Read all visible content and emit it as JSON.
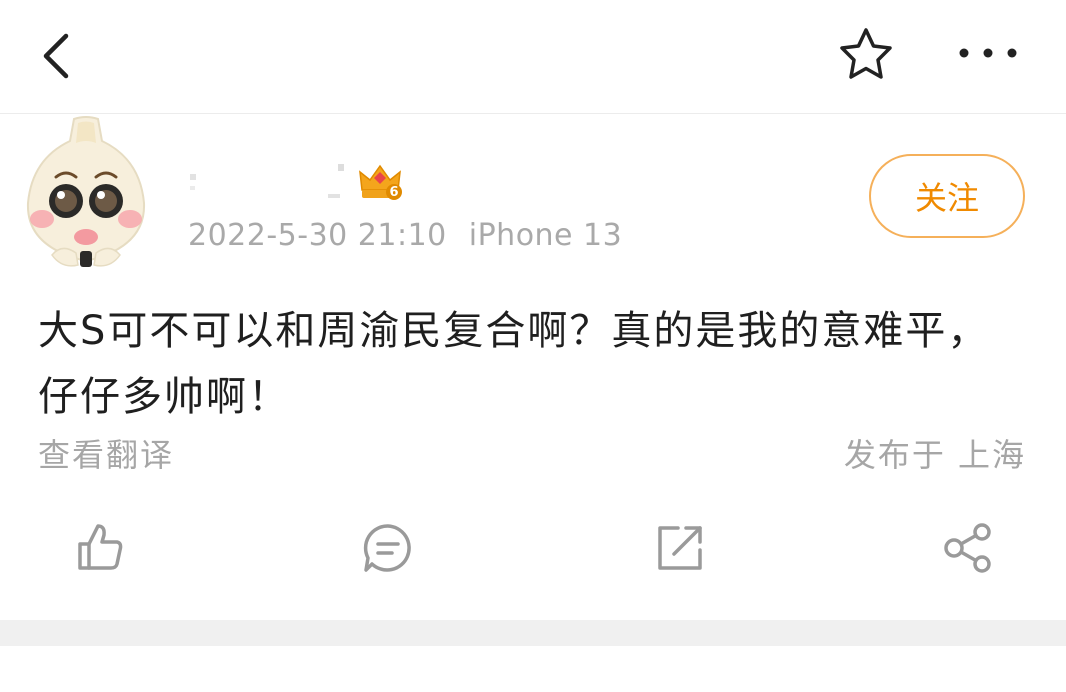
{
  "nav": {
    "back_icon": "chevron-left-icon",
    "favorite_icon": "star-outline-icon",
    "more_icon": "more-horizontal-icon"
  },
  "post": {
    "author": {
      "avatar": "garlic-character-avatar",
      "badge_icon": "crown-level-badge-icon",
      "badge_level": "6"
    },
    "date": "2022-5-30 21:10",
    "device": "iPhone 13",
    "follow_label": "关注",
    "text": "大S可不可以和周渝民复合啊？真的是我的意难平，仔仔多帅啊！",
    "translate_label": "查看翻译",
    "location": "发布于 上海"
  },
  "actions": [
    {
      "name": "like",
      "icon": "thumbs-up-icon"
    },
    {
      "name": "comment",
      "icon": "comment-bubble-icon"
    },
    {
      "name": "repost",
      "icon": "repost-arrow-icon"
    },
    {
      "name": "share",
      "icon": "share-nodes-icon"
    }
  ],
  "colors": {
    "accent": "#f08a00",
    "accent_border": "#f5b05a",
    "muted_text": "#a6a6a6",
    "icon_gray": "#9a9a9a"
  }
}
